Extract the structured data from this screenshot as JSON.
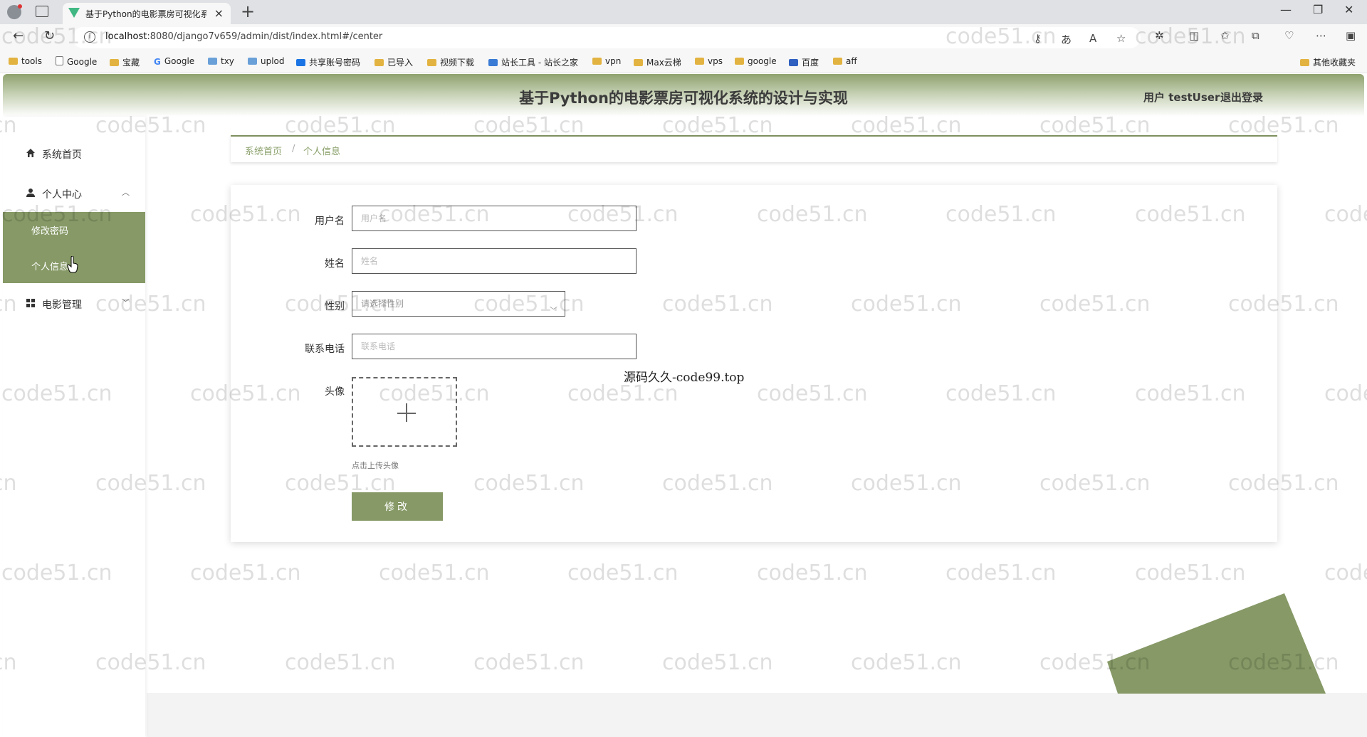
{
  "browser": {
    "tab_title": "基于Python的电影票房可视化系统",
    "url_host": "localhost",
    "url_rest": ":8080/django7v659/admin/dist/index.html#/center",
    "bookmarks": [
      "tools",
      "Google",
      "宝藏",
      "Google",
      "txy",
      "uplod",
      "共享账号密码",
      "已导入",
      "视频下载",
      "站长工具 - 站长之家",
      "vpn",
      "Max云梯",
      "vps",
      "google",
      "百度",
      "aff"
    ],
    "other_bookmarks": "其他收藏夹"
  },
  "header": {
    "title": "基于Python的电影票房可视化系统的设计与实现",
    "user_label": "用户 testUser",
    "logout_label": "退出登录"
  },
  "sidebar": {
    "items": [
      {
        "label": "系统首页",
        "icon": "home-icon"
      },
      {
        "label": "个人中心",
        "icon": "user-icon"
      },
      {
        "label": "电影管理",
        "icon": "grid-icon"
      }
    ],
    "subitems": [
      {
        "label": "修改密码"
      },
      {
        "label": "个人信息"
      }
    ]
  },
  "breadcrumb": {
    "home": "系统首页",
    "separator": "/",
    "current": "个人信息"
  },
  "form": {
    "username_label": "用户名",
    "username_placeholder": "用户名",
    "name_label": "姓名",
    "name_placeholder": "姓名",
    "gender_label": "性别",
    "gender_placeholder": "请选择性别",
    "phone_label": "联系电话",
    "phone_placeholder": "联系电话",
    "avatar_label": "头像",
    "upload_tip": "点击上传头像",
    "submit_label": "修改"
  },
  "overlay_text": "源码久久-code99.top",
  "watermark_text": "code51.cn",
  "colors": {
    "accent": "#869966",
    "header_top": "#8fa26f"
  }
}
